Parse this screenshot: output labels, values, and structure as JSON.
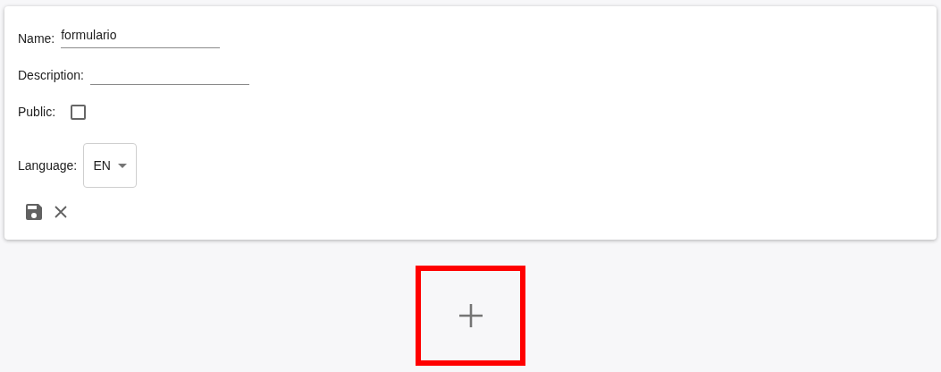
{
  "form": {
    "fields": [
      {
        "kind": "text",
        "label": "Name:",
        "value": "formulario"
      },
      {
        "kind": "text",
        "label": "Description:"
      },
      {
        "kind": "checkbox",
        "label": "Public:",
        "checked": false
      },
      {
        "kind": "select",
        "label": "Language:",
        "value": "EN"
      }
    ]
  },
  "add_button": {
    "selected": true
  }
}
